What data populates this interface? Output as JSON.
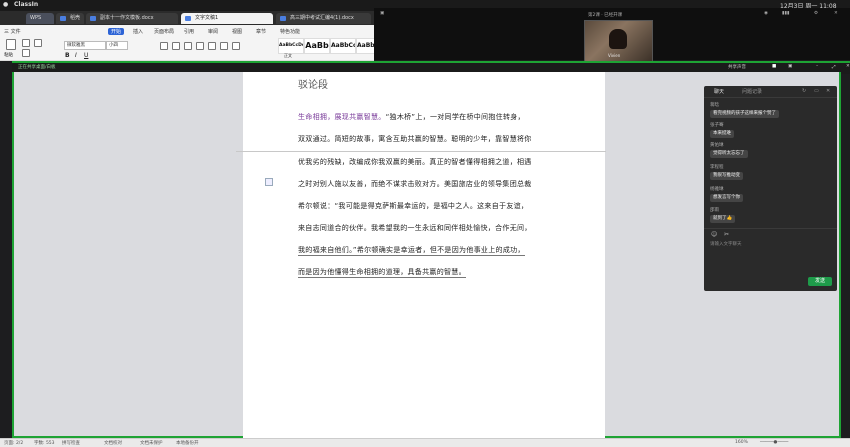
{
  "mac": {
    "app": "ClassIn",
    "time": "12月3日 周一 11:08"
  },
  "tabs": [
    {
      "label": "WPS"
    },
    {
      "label": "稻壳"
    },
    {
      "label": "副本十一作文模板.docx"
    },
    {
      "label": "文字文稿1"
    },
    {
      "label": "高三期中考试汇编4(1).docx"
    }
  ],
  "menu": [
    "三 文件",
    "开始",
    "插入",
    "页面布局",
    "引用",
    "审阅",
    "视图",
    "章节",
    "特色功能"
  ],
  "toolbar": {
    "paste": "粘贴",
    "font_name": "微软雅黑",
    "font_size": "小四",
    "styles": [
      "AaBbCcDd",
      "AaBb",
      "AaBbCc",
      "AaBbC"
    ],
    "style_labels": [
      "正文",
      "标题 1",
      "标题 2",
      "标题 3"
    ]
  },
  "video": {
    "label": "第2课 · 已经开课",
    "name": "Vivien"
  },
  "classin_bar": {
    "notice": "正在共享桌面/白板",
    "share": "共享声音"
  },
  "doc": {
    "heading": "驳论段",
    "lines": [
      "生命相拥，展现共赢智慧。“独木桥”上，一对同学在桥中间抱住转身，",
      "双双通过。简短的故事，寓含互助共赢的智慧。聪明的少年，靠智慧将你",
      "优我劣的残缺，改编成你我双赢的美丽。真正的智者懂得相拥之道，相遇",
      "之时对别人施以友善，而绝不谋求击败对方。美国旅店业的领导集团总裁",
      "希尔顿说：“我可能是得克萨斯最幸运的，是福中之人。这来自于友谊，",
      "来自志同道合的伙伴。我希望我的一生永远和同伴相处愉快，合作无间，",
      "我的福来自他们。”希尔顿确实是幸运者，但不是因为他事业上的成功，",
      "而是因为他懂得生命相拥的道理，具备共赢的智慧。"
    ],
    "first_highlight": "生命相拥，展现共赢智慧。"
  },
  "chat": {
    "tabs": [
      "聊天",
      "问题记录"
    ],
    "messages": [
      {
        "name": "蒋晗",
        "text": "看完视频的孩子这样来报个赞了"
      },
      {
        "name": "张子骞",
        "text": "本来挺难"
      },
      {
        "name": "黄佑琳",
        "text": "觉得听太忘忘了"
      },
      {
        "name": "李程程",
        "text": "我很写推动变"
      },
      {
        "name": "杨雅琳",
        "text": "想发言写个你"
      },
      {
        "name": "邵雨",
        "text": "就到了👍"
      }
    ],
    "placeholder": "请输入文字聊天",
    "send": "发送"
  },
  "status": {
    "page": "页面: 2/2",
    "words": "字数: 553",
    "spell": "拼写检查",
    "proofread": "文档校对",
    "protect": "文档未保护",
    "backup": "本地备份开",
    "zoom": "160%"
  },
  "colors": {
    "accent_green": "#1ea334",
    "wps_blue": "#2d64d6",
    "highlight_purple": "#7a3b9a"
  }
}
